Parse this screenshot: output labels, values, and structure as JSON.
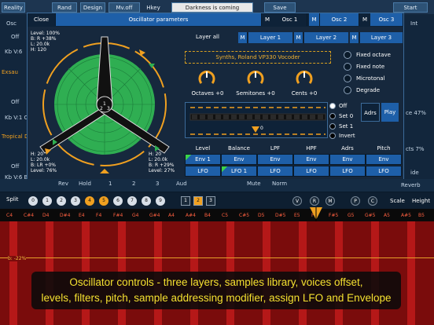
{
  "background": {
    "top_buttons": [
      "Reality",
      "Rand",
      "Design",
      "Mv.off",
      "Hkey",
      "Save",
      "Start"
    ],
    "darkness_text": "Darkness is coming",
    "left_labels": [
      "Osc",
      "Off",
      "Kb V:6",
      "Exsau",
      "Off",
      "Kb V:1 C",
      "Tropical D",
      "Off",
      "Kb V:6 B"
    ],
    "right_labels": [
      "Int",
      "ce 47%",
      "cts 7%",
      "ide",
      "Reverb"
    ],
    "mid_buttons": [
      "Rev",
      "Hold",
      "1",
      "2",
      "3",
      "Aud",
      "Mute",
      "Norm",
      "Reverb"
    ]
  },
  "dialog": {
    "close_label": "Close",
    "title": "Oscillator parameters",
    "osc_tabs": [
      {
        "m": "M",
        "label": "Osc 1"
      },
      {
        "m": "M",
        "label": "Osc 2"
      },
      {
        "m": "M",
        "label": "Osc 3"
      }
    ],
    "layer_all": "Layer all",
    "layers": [
      {
        "m": "M",
        "label": "Layer 1"
      },
      {
        "m": "M",
        "label": "Layer 2"
      },
      {
        "m": "M",
        "label": "Layer 3"
      }
    ],
    "sample_name": "Synths, Roland VP330 Vocoder",
    "knobs": [
      {
        "label": "Octaves +0"
      },
      {
        "label": "Semitones +0"
      },
      {
        "label": "Cents +0"
      }
    ],
    "radio_options": [
      {
        "label": "Fixed octave",
        "selected": false
      },
      {
        "label": "Fixed note",
        "selected": false
      },
      {
        "label": "Microtonal",
        "selected": false
      },
      {
        "label": "Degrade",
        "selected": false
      }
    ],
    "seq_options": [
      {
        "label": "Off",
        "selected": true
      },
      {
        "label": "Set 0",
        "selected": false
      },
      {
        "label": "Set 1",
        "selected": false
      },
      {
        "label": "Invert",
        "selected": false
      }
    ],
    "seq_marker": "0",
    "adrs_label": "Adrs",
    "play_label": "Play",
    "columns": [
      "Level",
      "Balance",
      "LPF",
      "HPF",
      "Adrs",
      "Pitch"
    ],
    "row_env": [
      "Env 1",
      "Env",
      "Env",
      "Env",
      "Env",
      "Env"
    ],
    "row_lfo": [
      "LFO",
      "LFO 1",
      "LFO",
      "LFO",
      "LFO",
      "LFO"
    ],
    "radar": {
      "top_left": [
        "Level: 100%",
        "B: R +38%",
        "L: 20.0k",
        "H: 120"
      ],
      "bottom_left": [
        "H: 20",
        "L: 20.0k",
        "B: LR +0%",
        "Level: 76%"
      ],
      "bottom_right": [
        "H: 20",
        "L: 20.0k",
        "B: R +29%",
        "Level: 27%"
      ],
      "center_labels": [
        "1",
        "2",
        "3"
      ]
    }
  },
  "split": {
    "label": "Split",
    "numbers": [
      "0",
      "1",
      "2",
      "3",
      "4",
      "5",
      "6",
      "7",
      "8",
      "9"
    ],
    "squares": [
      "1",
      "2",
      "3"
    ],
    "selected_square": "2",
    "markers": [
      "V",
      "R",
      "M",
      "P",
      "C"
    ],
    "scale_label": "Scale",
    "height_label": "Height"
  },
  "keyboard": {
    "notes": [
      "C4",
      "C#4",
      "D4",
      "D#4",
      "E4",
      "F4",
      "F#4",
      "G4",
      "G#4",
      "A4",
      "A#4",
      "B4",
      "C5",
      "C#5",
      "D5",
      "D#5",
      "E5",
      "F5",
      "F#5",
      "G5",
      "G#5",
      "A5",
      "A#5",
      "B5"
    ]
  },
  "roll_label": "b: -22%",
  "caption": {
    "line1": "Oscillator controls - three layers, samples library, voices offset,",
    "line2": "levels, filters, pitch, sample addressing modifier, assign LFO and Envelope"
  },
  "colors": {
    "accent": "#1e5fa8",
    "radar_green": "#2fae52",
    "orange": "#f0a020",
    "roll_red": "#b51818"
  }
}
